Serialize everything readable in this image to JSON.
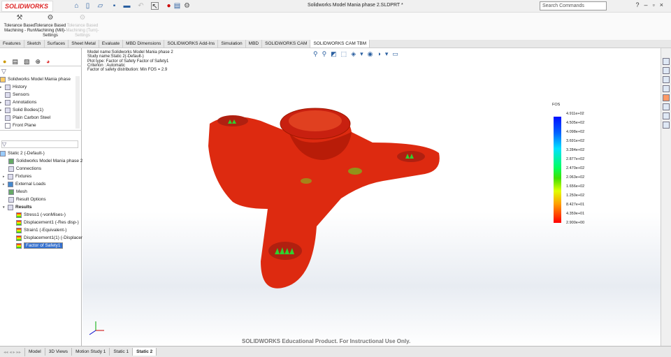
{
  "app": {
    "logo": "SOLIDWORKS",
    "title": "Solidworks Model Mania phase 2.SLDPRT *",
    "search_placeholder": "Search Commands"
  },
  "ribbon": [
    {
      "label": "Tolerance Based Machining - Run"
    },
    {
      "label": "Tolerance Based Machining (Mill)- Settings"
    },
    {
      "label": "Tolerance Based Machining (Turn)- Settings"
    }
  ],
  "tabs": [
    "Features",
    "Sketch",
    "Surfaces",
    "Sheet Metal",
    "Evaluate",
    "MBD Dimensions",
    "SOLIDWORKS Add-Ins",
    "Simulation",
    "MBD",
    "SOLIDWORKS CAM",
    "SOLIDWORKS CAM TBM"
  ],
  "feature_tree": [
    "Solidworks Model Mania phase",
    "History",
    "Sensors",
    "Annotations",
    "Solid Bodies(1)",
    "Plain Carbon Steel",
    "Front Plane"
  ],
  "study_tree": {
    "root": "Static 2 (-Default-)",
    "items": [
      "Solidworks Model Mania phase 2 (-",
      "Connections",
      "Fixtures",
      "External Loads",
      "Mesh",
      "Result Options",
      "Results"
    ],
    "results": [
      "Stress1 (-vonMises-)",
      "Displacement1 (-Res disp-)",
      "Strain1 (-Equivalent-)",
      "Displacement1(1) (-Displacem",
      "Factor of Safety1"
    ]
  },
  "info": [
    "Model name:Solidworks Model Mania phase 2",
    "Study name:Static 2(-Default-)",
    "Plot type: Factor of Safety Factor of Safety1",
    "Criterion : Automatic",
    "Factor of safety distribution: Min FOS = 2.9"
  ],
  "legend": {
    "title": "FOS",
    "labels": [
      "4.911e+02",
      "4.505e+02",
      "4.098e+02",
      "3.691e+02",
      "3.284e+02",
      "2.877e+02",
      "2.470e+02",
      "2.063e+02",
      "1.656e+02",
      "1.250e+02",
      "8.427e+01",
      "4.359e+01",
      "2.900e+00"
    ]
  },
  "watermark": "SOLIDWORKS Educational Product. For Instructional Use Only.",
  "bottom_tabs": [
    "Model",
    "3D Views",
    "Motion Study 1",
    "Static 1",
    "Static 2"
  ]
}
